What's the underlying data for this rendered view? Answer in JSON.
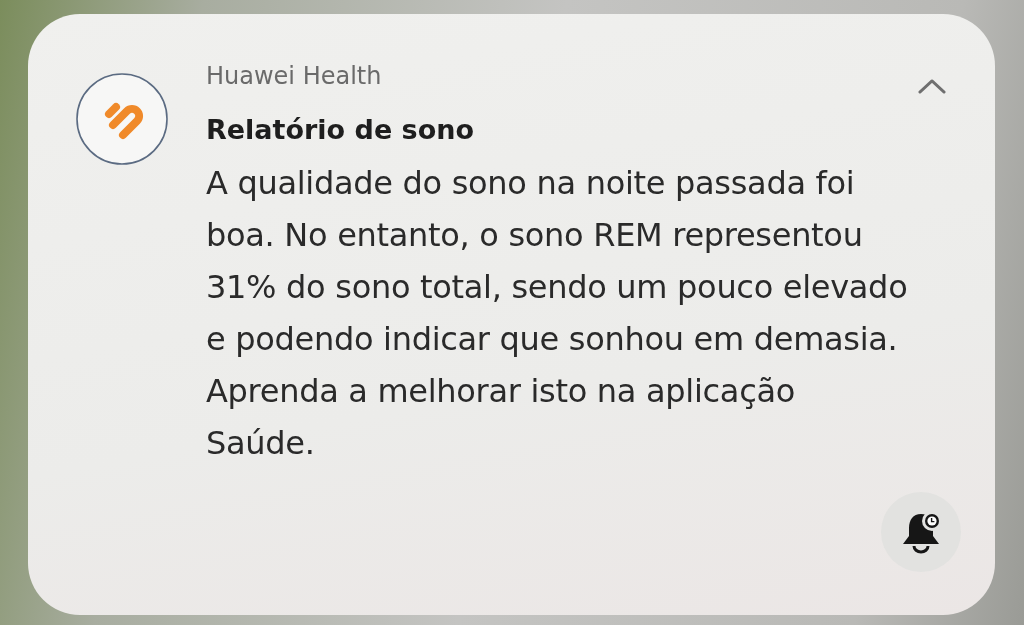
{
  "notification": {
    "app_name": "Huawei Health",
    "title": "Relatório de sono",
    "body": "A qualidade do sono na noite passada foi boa. No entanto, o sono REM representou 31% do sono total, sendo um pouco elevado e podendo indicar que sonhou em demasia. Aprenda a melhorar isto na aplicação Saúde.",
    "expanded": true
  }
}
